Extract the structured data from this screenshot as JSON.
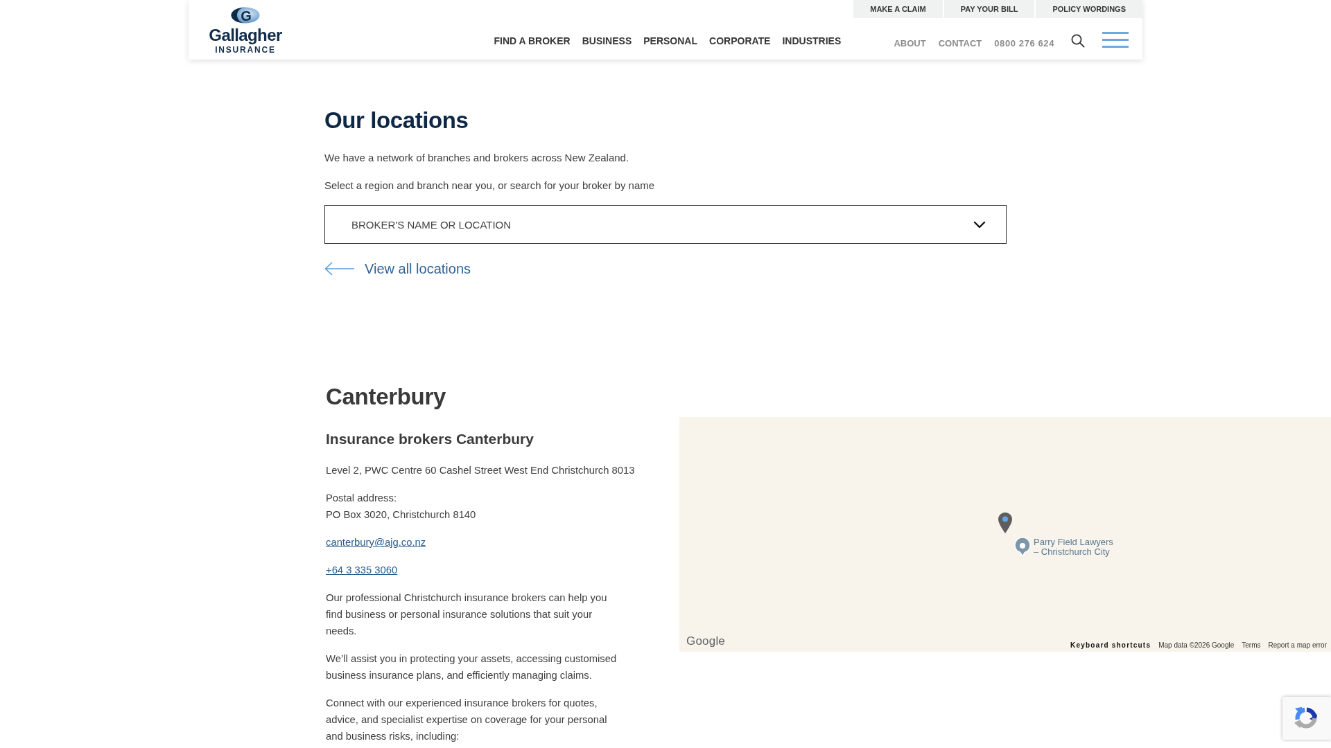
{
  "header": {
    "logo": {
      "emblem_letter": "G",
      "wordmark": "Gallagher",
      "tagline": "INSURANCE"
    },
    "main_nav": [
      "FIND A BROKER",
      "BUSINESS",
      "PERSONAL",
      "CORPORATE",
      "INDUSTRIES"
    ],
    "utility_links": [
      "MAKE A CLAIM",
      "PAY YOUR BILL",
      "POLICY WORDINGS"
    ],
    "secondary_nav": [
      "ABOUT",
      "CONTACT",
      "0800 276 624"
    ]
  },
  "locations": {
    "title": "Our locations",
    "intro": "We have a network of branches and brokers across New Zealand.",
    "instruction": "Select a region and branch near you, or search for your broker by name",
    "broker_search": {
      "placeholder": "BROKER'S NAME OR LOCATION"
    },
    "view_all_link": "View all locations"
  },
  "region": {
    "title": "Canterbury",
    "subtitle": "Insurance brokers Canterbury",
    "address": "Level 2, PWC Centre 60 Cashel Street West End Christchurch 8013",
    "postal_label": "Postal address:",
    "postal_address": "PO Box 3020, Christchurch 8140",
    "email": "canterbury@ajg.co.nz",
    "phone": "+64 3 335 3060",
    "paragraphs": [
      "Our professional Christchurch insurance brokers can help you find business or personal insurance solutions that suit your needs.",
      "We’ll assist you in protecting your assets, accessing customised business insurance plans, and efficiently managing claims.",
      "Connect with our experienced insurance brokers for quotes, advice, and specialist expertise on coverage for your personal and business risks, including:"
    ]
  },
  "map": {
    "place_label": "Parry Field Lawyers\n– Christchurch City",
    "logo": "Google",
    "footer_links": [
      {
        "label": "Keyboard shortcuts",
        "kind": "button"
      },
      {
        "label": "Map data ©2026 Google",
        "kind": "attribution"
      },
      {
        "label": "Terms",
        "kind": "link"
      },
      {
        "label": "Report a map error",
        "kind": "link"
      }
    ]
  }
}
